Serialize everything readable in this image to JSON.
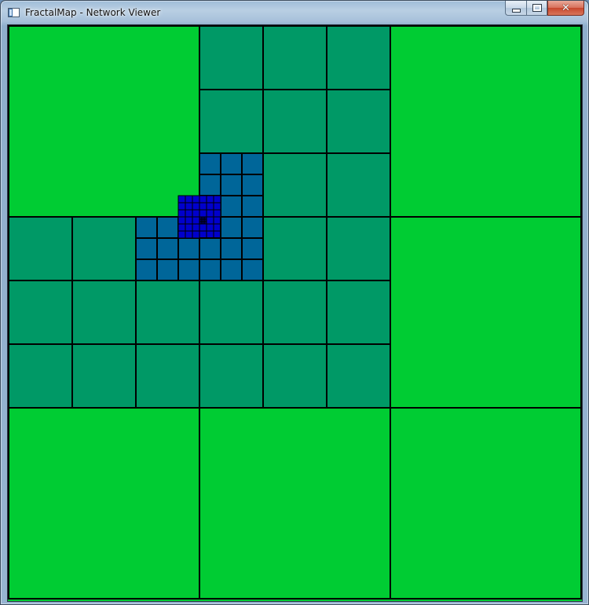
{
  "window": {
    "title": "FractalMap - Network Viewer",
    "app_icon": "window-app-icon"
  },
  "caption_buttons": {
    "minimize_icon": "minimize-icon",
    "maximize_icon": "maximize-icon",
    "close_icon": "close-icon",
    "close_glyph": "✕"
  },
  "colors": {
    "level1": "#00cc33",
    "level2": "#009966",
    "level3": "#006699",
    "level4": "#0000cc",
    "level5": "#000066",
    "grid_line": "#000000"
  },
  "map": {
    "description_levels": 5
  }
}
